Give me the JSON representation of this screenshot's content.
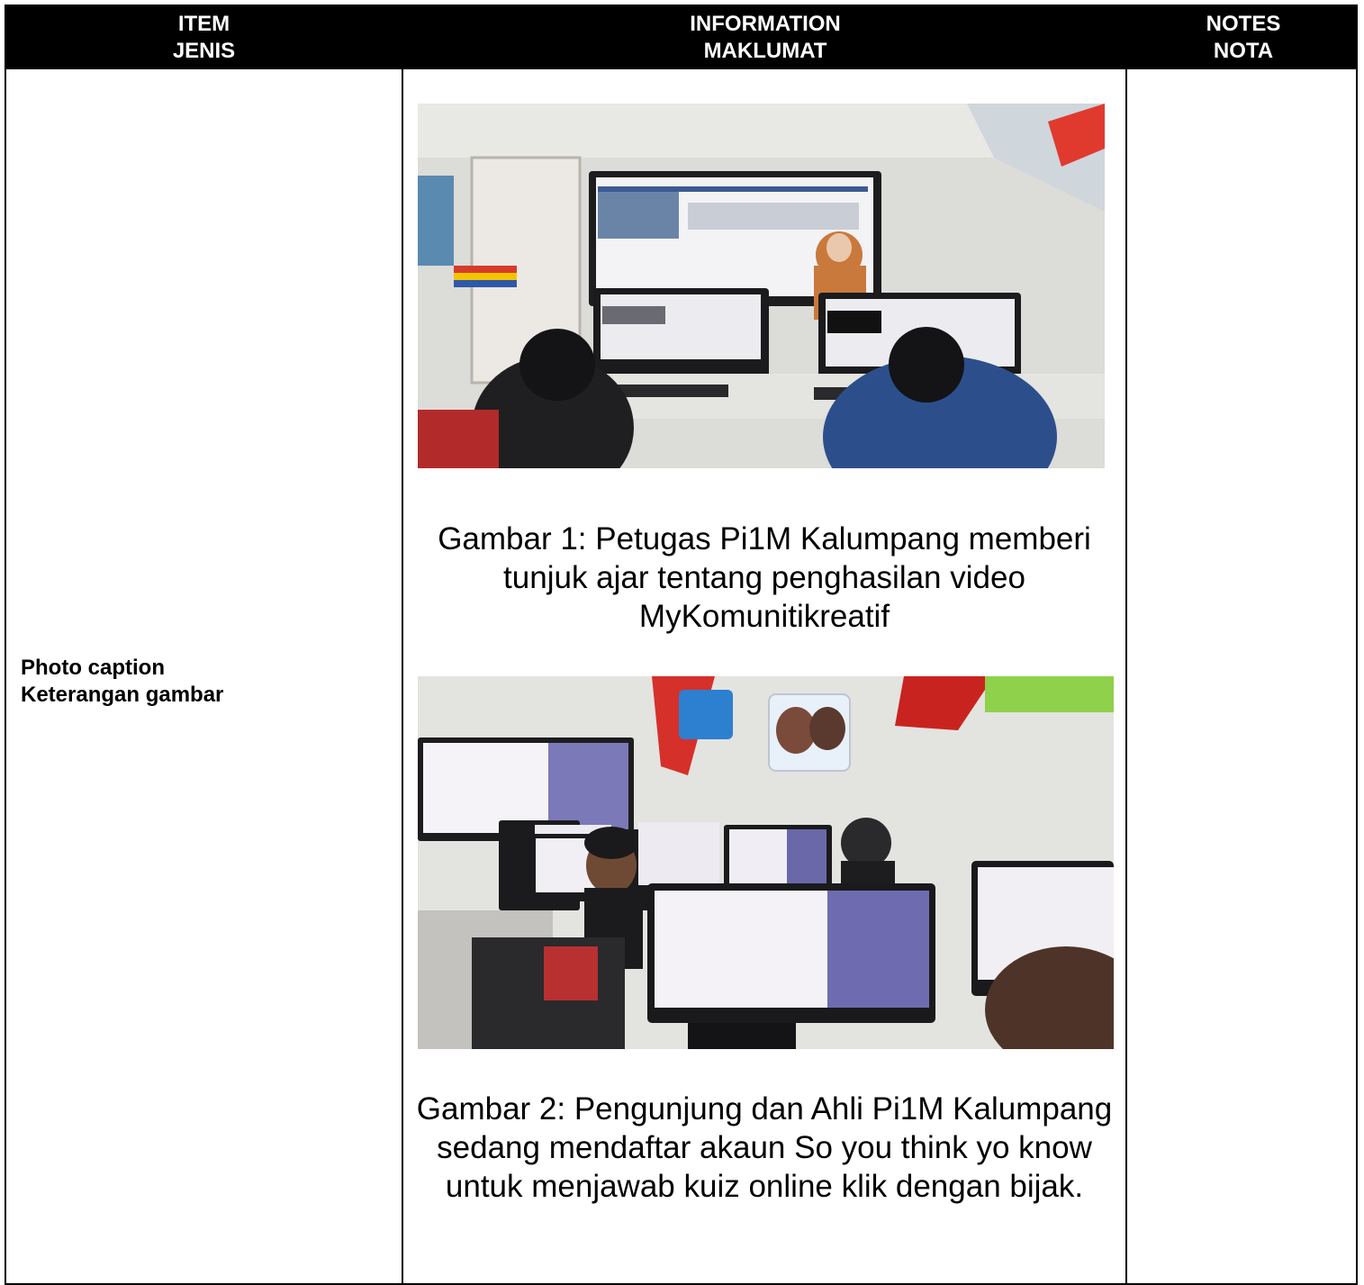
{
  "header": {
    "col1_line1": "ITEM",
    "col1_line2": "JENIS",
    "col2_line1": "INFORMATION",
    "col2_line2": "MAKLUMAT",
    "col3_line1": "NOTES",
    "col3_line2": "NOTA"
  },
  "row": {
    "item_line1": "Photo caption",
    "item_line2": "Keterangan gambar"
  },
  "photos": [
    {
      "caption": "Gambar 1: Petugas Pi1M Kalumpang memberi tunjuk ajar tentang penghasilan video MyKomunitikreatif"
    },
    {
      "caption": "Gambar 2: Pengunjung dan Ahli Pi1M Kalumpang sedang mendaftar akaun So you think yo know untuk menjawab kuiz online klik dengan bijak."
    }
  ],
  "colors": {
    "header_bg": "#000000",
    "header_text": "#ffffff",
    "border": "#000000"
  }
}
